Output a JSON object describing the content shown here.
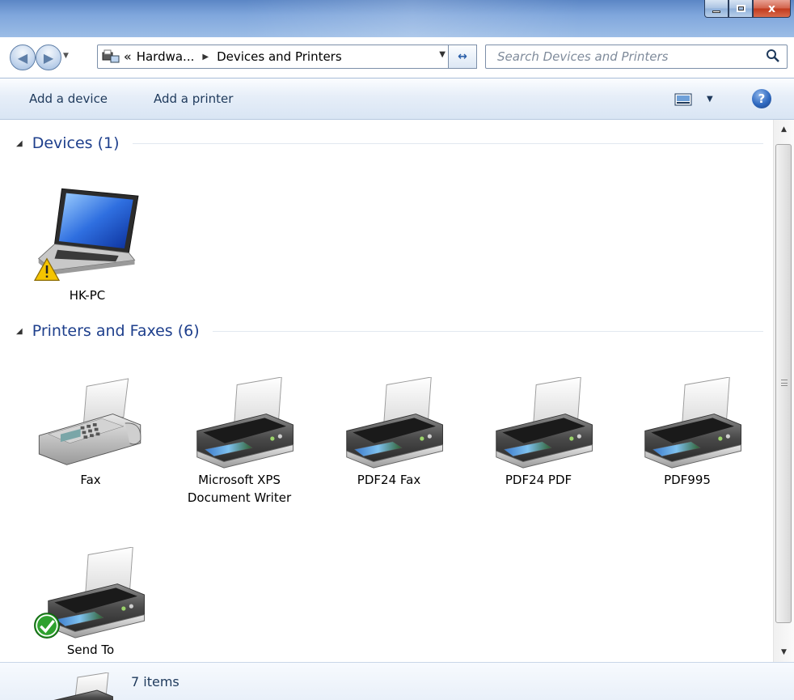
{
  "window": {
    "caption_buttons": {
      "minimize": "minimize-icon",
      "maximize": "maximize-icon",
      "close": "x"
    }
  },
  "nav": {
    "back_icon": "arrow-left-icon",
    "forward_icon": "arrow-right-icon"
  },
  "address": {
    "overflow_chevron": "«",
    "crumbs": [
      "Hardwa...",
      "Devices and Printers"
    ],
    "separator": "▶"
  },
  "search": {
    "placeholder": "Search Devices and Printers"
  },
  "toolbar": {
    "add_device_label": "Add a device",
    "add_printer_label": "Add a printer",
    "help_label": "?"
  },
  "groups": {
    "devices": {
      "title": "Devices (1)",
      "items": [
        {
          "label": "HK-PC",
          "icon": "laptop-icon",
          "status": "warning"
        }
      ]
    },
    "printers": {
      "title": "Printers and Faxes (6)",
      "items": [
        {
          "label": "Fax",
          "icon": "fax-icon"
        },
        {
          "label": "Microsoft XPS\nDocument Writer",
          "icon": "printer-icon"
        },
        {
          "label": "PDF24 Fax",
          "icon": "printer-icon"
        },
        {
          "label": "PDF24 PDF",
          "icon": "printer-icon"
        },
        {
          "label": "PDF995",
          "icon": "printer-icon"
        },
        {
          "label": "Send To",
          "icon": "printer-icon",
          "status": "default"
        }
      ]
    }
  },
  "details": {
    "count": "7 items"
  },
  "colors": {
    "group_title": "#1e3f8c",
    "command_text": "#1e395b",
    "close_button": "#c1391d"
  }
}
